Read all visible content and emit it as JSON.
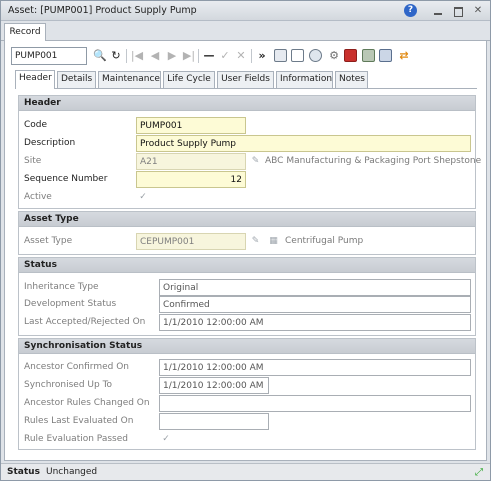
{
  "window": {
    "title": "Asset: [PUMP001] Product Supply Pump"
  },
  "record_tab": "Record",
  "toolbar": {
    "code_value": "PUMP001"
  },
  "tabs": [
    "Header",
    "Details",
    "Maintenance",
    "Life Cycle",
    "User Fields",
    "Information",
    "Notes"
  ],
  "header": {
    "title": "Header",
    "code_label": "Code",
    "code_value": "PUMP001",
    "description_label": "Description",
    "description_value": "Product Supply Pump",
    "site_label": "Site",
    "site_value": "A21",
    "site_name": "ABC Manufacturing & Packaging Port Shepstone",
    "seq_label": "Sequence Number",
    "seq_value": "12",
    "active_label": "Active"
  },
  "asset_type": {
    "title": "Asset Type",
    "label": "Asset Type",
    "value": "CEPUMP001",
    "name": "Centrifugal Pump"
  },
  "status": {
    "title": "Status",
    "inheritance_label": "Inheritance Type",
    "inheritance_value": "Original",
    "dev_label": "Development Status",
    "dev_value": "Confirmed",
    "accepted_label": "Last Accepted/Rejected On",
    "accepted_value": "1/1/2010 12:00:00 AM"
  },
  "sync": {
    "title": "Synchronisation Status",
    "ancestor_label": "Ancestor Confirmed On",
    "ancestor_value": "1/1/2010 12:00:00 AM",
    "syncup_label": "Synchronised Up To",
    "syncup_value": "1/1/2010 12:00:00 AM",
    "rules_changed_label": "Ancestor Rules Changed On",
    "rules_changed_value": "",
    "rules_eval_label": "Rules Last Evaluated On",
    "rules_eval_value": "",
    "rule_passed_label": "Rule Evaluation Passed"
  },
  "statusbar": {
    "label": "Status",
    "value": "Unchanged"
  }
}
